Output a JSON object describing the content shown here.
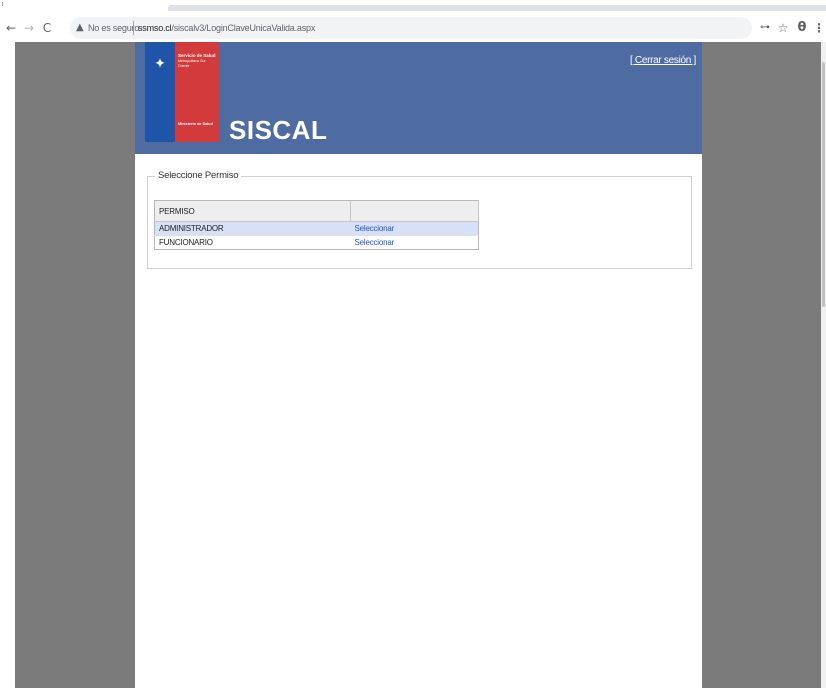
{
  "browser": {
    "security_label": "No es seguro",
    "url_domain": "ssmso.cl",
    "url_path": "/siscalv3/LoginClaveUnicaValida.aspx"
  },
  "header": {
    "org_name": "Servicio de Salud",
    "org_sub": "Metropolitano Sur Oriente",
    "ministry": "Ministerio de Salud",
    "app_title": "SISCAL",
    "logout_label": "[ Cerrar sesión ]"
  },
  "permissions": {
    "legend": "Seleccione Permiso",
    "columns": [
      "PERMISO",
      ""
    ],
    "rows": [
      {
        "name": "ADMINISTRADOR",
        "action": "Seleccionar"
      },
      {
        "name": "FUNCIONARIO",
        "action": "Seleccionar"
      }
    ]
  },
  "colors": {
    "header_bg": "#4e6ca2",
    "flag_blue": "#1f55a8",
    "flag_red": "#d23a3b",
    "link": "#2255cc",
    "selected_row": "#d6e1f7",
    "page_gutter": "#7b7b7b"
  },
  "icons": {
    "back": "back-arrow-icon",
    "forward": "forward-arrow-icon",
    "reload": "reload-icon",
    "warning": "warning-icon",
    "key": "key-icon",
    "star": "star-icon",
    "profile": "profile-icon",
    "menu": "menu-dots-icon"
  }
}
